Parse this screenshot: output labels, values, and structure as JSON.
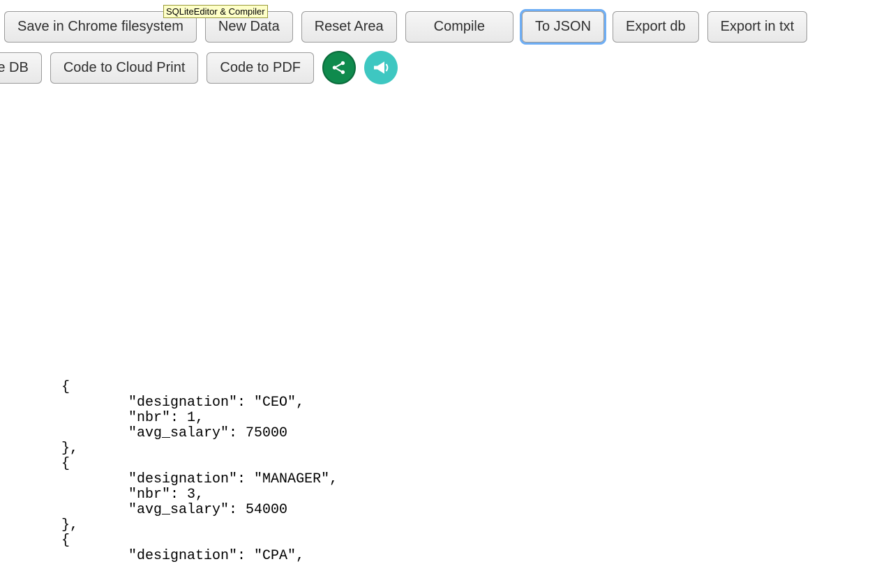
{
  "tooltip": "SQLiteEditor & Compiler",
  "row1": {
    "input_value": "",
    "save_chrome": "Save in Chrome filesystem",
    "new_data": "New Data",
    "reset_area": "Reset Area",
    "compile": "Compile",
    "to_json": "To JSON",
    "export_db": "Export db",
    "export_txt": "Export in txt"
  },
  "row2": {
    "sqlite_db": "or SQLite DB",
    "cloud_print": "Code to Cloud Print",
    "code_pdf": "Code to PDF"
  },
  "json_out": "    {\n            \"designation\": \"CEO\",\n            \"nbr\": 1,\n            \"avg_salary\": 75000\n    },\n    {\n            \"designation\": \"MANAGER\",\n            \"nbr\": 3,\n            \"avg_salary\": 54000\n    },\n    {\n            \"designation\": \"CPA\","
}
